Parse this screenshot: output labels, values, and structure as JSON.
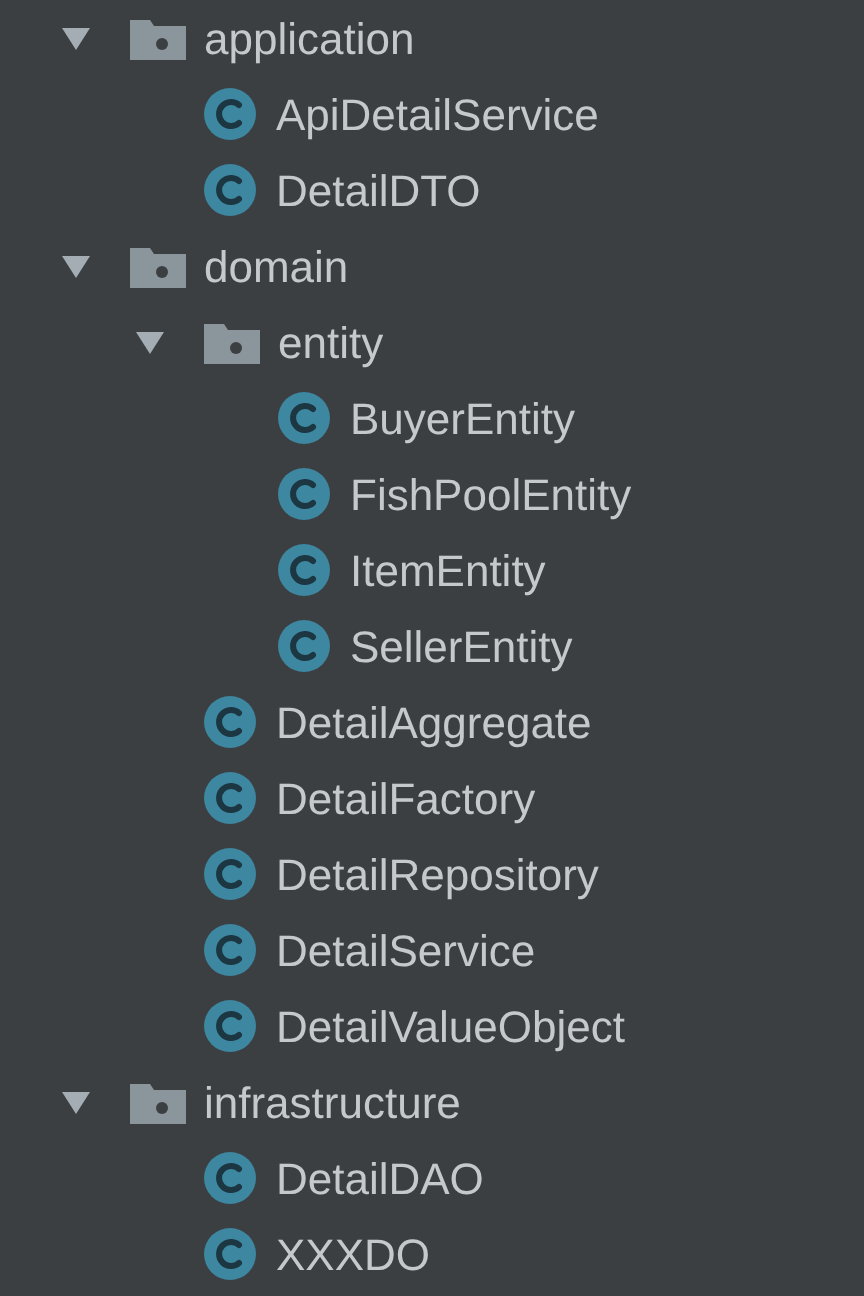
{
  "tree": [
    {
      "kind": "folder",
      "label": "application",
      "expanded": true,
      "children": [
        {
          "kind": "class",
          "label": "ApiDetailService"
        },
        {
          "kind": "class",
          "label": "DetailDTO"
        }
      ]
    },
    {
      "kind": "folder",
      "label": "domain",
      "expanded": true,
      "children": [
        {
          "kind": "folder",
          "label": "entity",
          "expanded": true,
          "children": [
            {
              "kind": "class",
              "label": "BuyerEntity"
            },
            {
              "kind": "class",
              "label": "FishPoolEntity"
            },
            {
              "kind": "class",
              "label": "ItemEntity"
            },
            {
              "kind": "class",
              "label": "SellerEntity"
            }
          ]
        },
        {
          "kind": "class",
          "label": "DetailAggregate"
        },
        {
          "kind": "class",
          "label": "DetailFactory"
        },
        {
          "kind": "class",
          "label": "DetailRepository"
        },
        {
          "kind": "class",
          "label": "DetailService"
        },
        {
          "kind": "class",
          "label": "DetailValueObject"
        }
      ]
    },
    {
      "kind": "folder",
      "label": "infrastructure",
      "expanded": true,
      "children": [
        {
          "kind": "class",
          "label": "DetailDAO"
        },
        {
          "kind": "class",
          "label": "XXXDO"
        }
      ]
    }
  ]
}
